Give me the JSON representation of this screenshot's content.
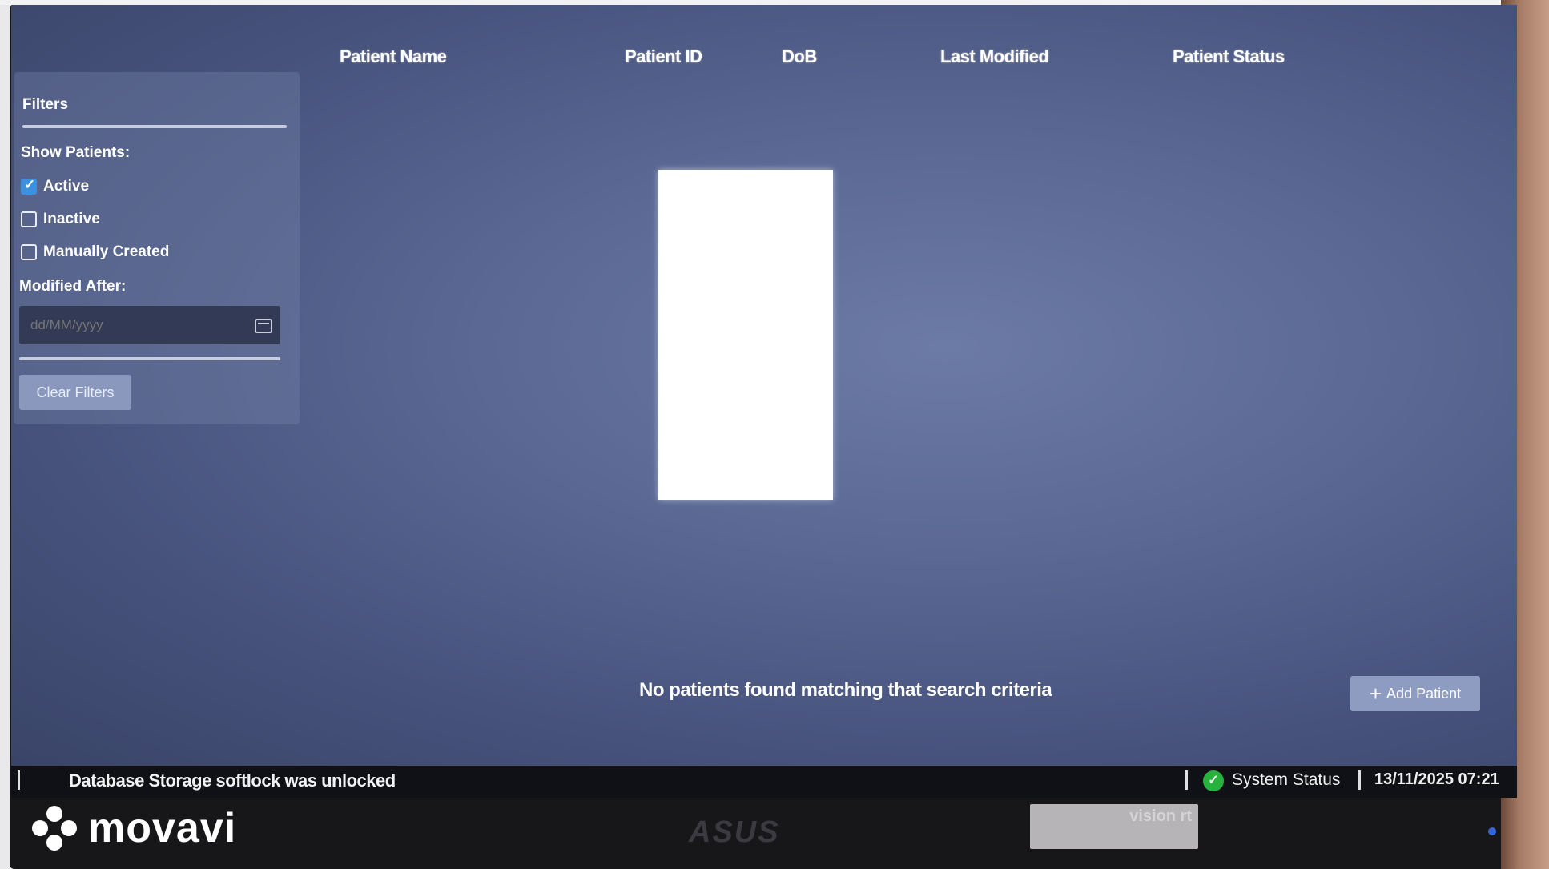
{
  "table_headers": {
    "name": "Patient Name",
    "id": "Patient ID",
    "dob": "DoB",
    "modified": "Last Modified",
    "status": "Patient Status"
  },
  "filters": {
    "title": "Filters",
    "show_label": "Show Patients:",
    "options": [
      {
        "label": "Active",
        "checked": true
      },
      {
        "label": "Inactive",
        "checked": false
      },
      {
        "label": "Manually Created",
        "checked": false
      }
    ],
    "modified_after_label": "Modified After:",
    "date_placeholder": "dd/MM/yyyy",
    "clear_label": "Clear Filters"
  },
  "empty_message": "No patients found matching that search criteria",
  "add_patient_label": "Add Patient",
  "statusbar": {
    "message": "Database Storage softlock was unlocked",
    "system_status": "System Status",
    "datetime": "13/11/2025 07:21"
  },
  "sticker_brand": "vision rt",
  "watermark": "movavi",
  "colors": {
    "screen": "#5a6893",
    "status_ok": "#27b23e",
    "checkbox": "#3d8fe0"
  }
}
